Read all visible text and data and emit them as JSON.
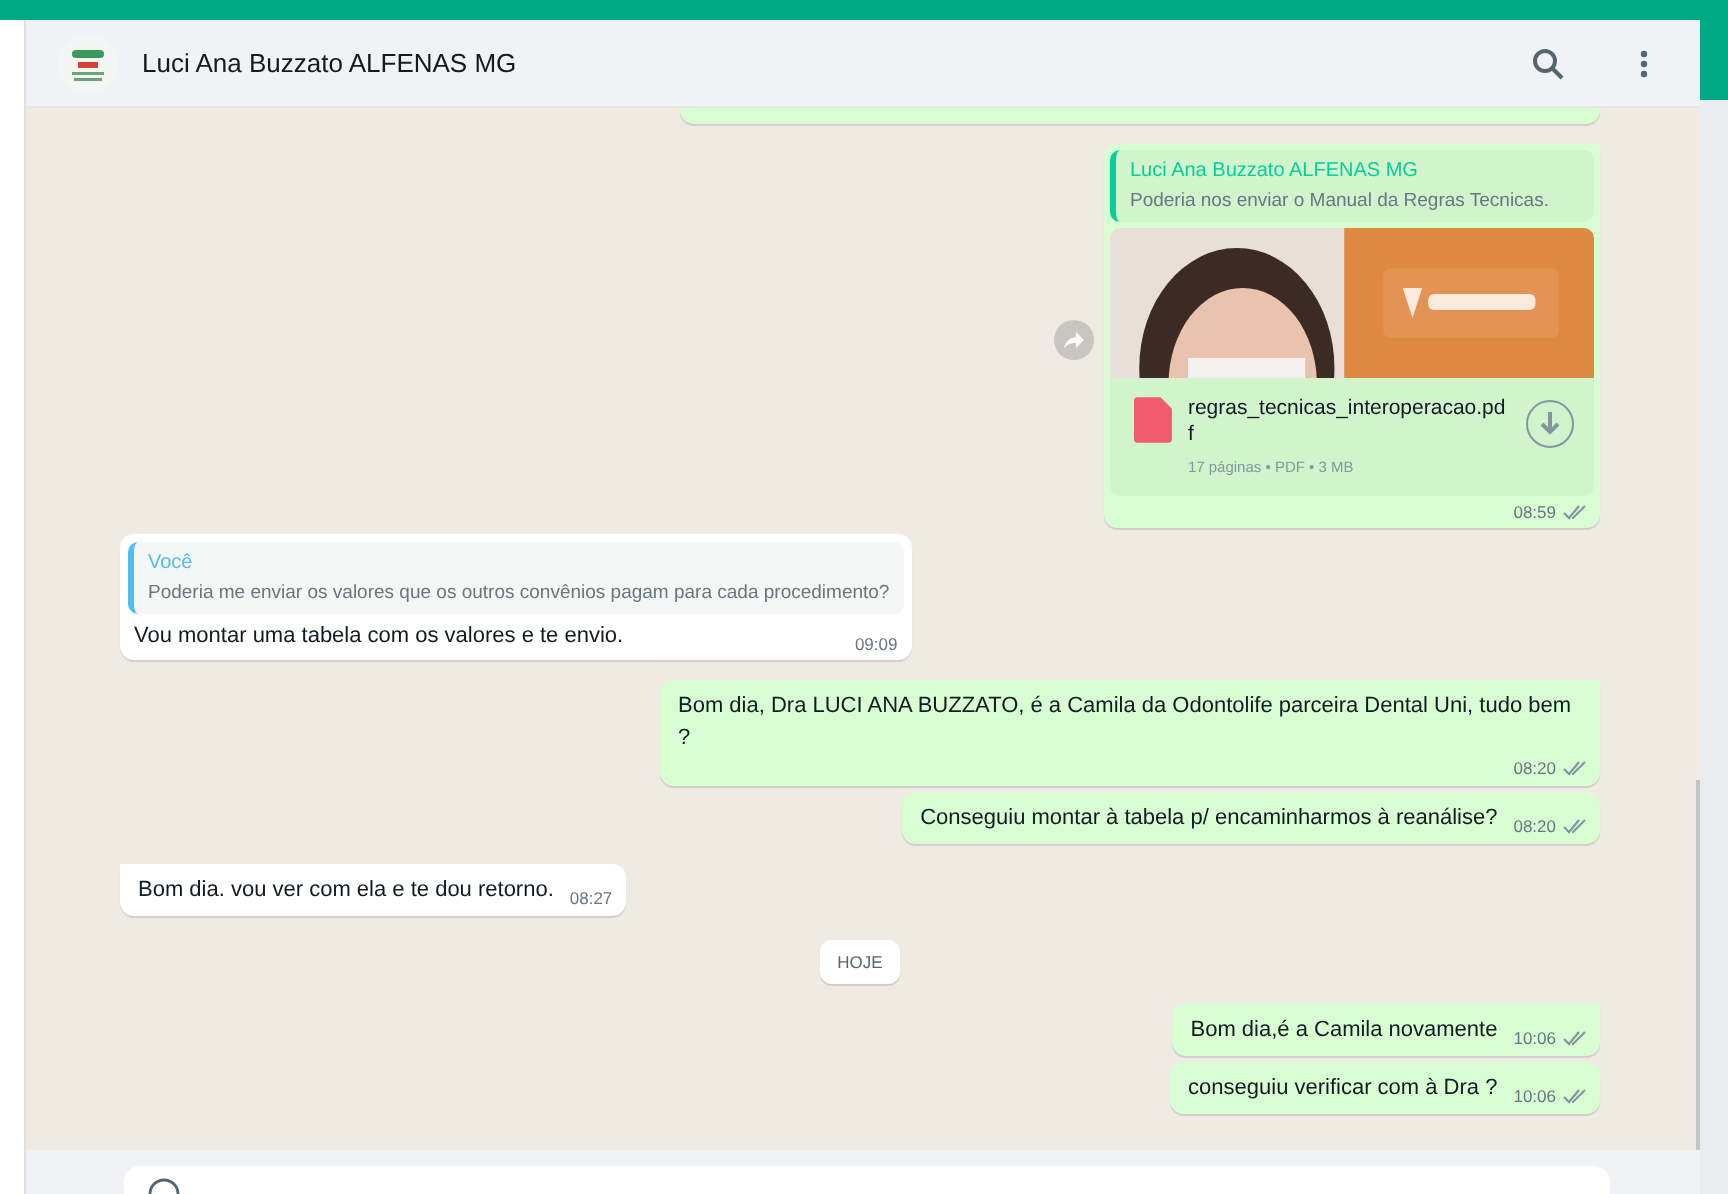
{
  "header": {
    "title": "Luci Ana Buzzato ALFENAS MG"
  },
  "messages": [
    {
      "kind": "stub",
      "outgoing": true
    },
    {
      "kind": "document",
      "outgoing": true,
      "tail": true,
      "read": false,
      "quote": {
        "author": "Luci Ana Buzzato ALFENAS MG",
        "text": "Poderia nos enviar o Manual da Regras Tecnicas.",
        "color": "#06cf9c"
      },
      "file": {
        "name": "regras_tecnicas_interoperacao.pdf",
        "meta": "17 páginas • PDF • 3 MB"
      },
      "time": "08:59"
    },
    {
      "kind": "quoted",
      "outgoing": false,
      "tail": false,
      "quote": {
        "author": "Você",
        "text": "Poderia me enviar os valores que os outros convênios pagam para cada procedimento?",
        "color": "#53bdeb"
      },
      "text": "Vou montar uma tabela com os valores e te envio.",
      "time": "09:09"
    },
    {
      "kind": "text",
      "outgoing": true,
      "tail": true,
      "read": false,
      "text": "Bom dia, Dra LUCI ANA BUZZATO, é a Camila da Odontolife parceira Dental Uni, tudo bem ?",
      "time": "08:20"
    },
    {
      "kind": "text",
      "outgoing": true,
      "tail": false,
      "read": false,
      "text": "Conseguiu montar à tabela p/ encaminharmos à reanálise?",
      "time": "08:20"
    },
    {
      "kind": "text",
      "outgoing": false,
      "tail": true,
      "text": "Bom dia. vou ver com ela e te dou retorno.",
      "time": "08:27"
    },
    {
      "kind": "date",
      "text": "HOJE"
    },
    {
      "kind": "text",
      "outgoing": true,
      "tail": true,
      "read": false,
      "text": "Bom dia,é a Camila novamente",
      "time": "10:06"
    },
    {
      "kind": "text",
      "outgoing": true,
      "tail": false,
      "read": false,
      "text": "conseguiu verificar com à Dra ?",
      "time": "10:06"
    }
  ]
}
